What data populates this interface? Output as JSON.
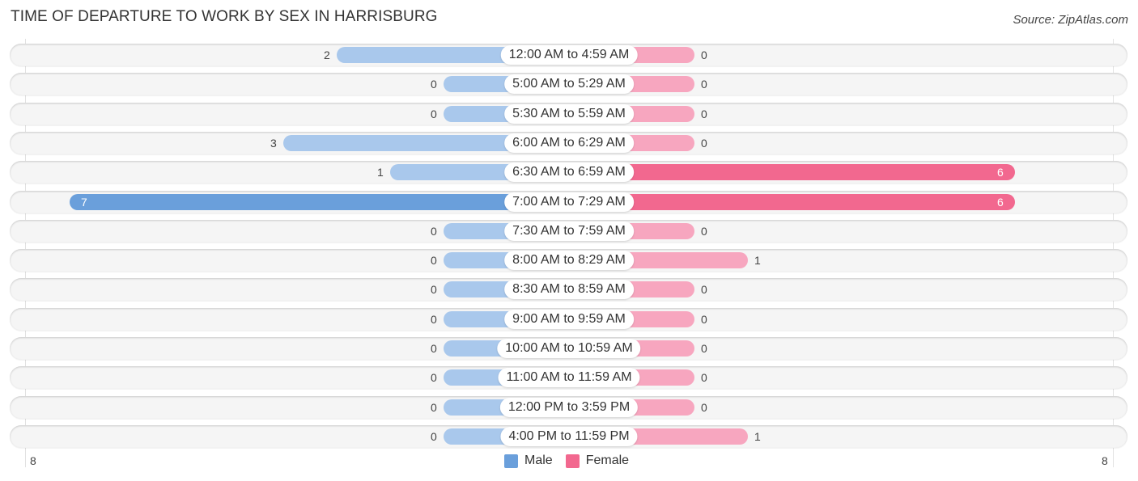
{
  "title": "TIME OF DEPARTURE TO WORK BY SEX IN HARRISBURG",
  "source": "Source: ZipAtlas.com",
  "colors": {
    "male": "#6a9fdb",
    "male_light": "#a9c8ec",
    "female": "#f2688f",
    "female_light": "#f7a6bf"
  },
  "chart_data": {
    "type": "bar",
    "orientation": "horizontal-diverging",
    "title": "TIME OF DEPARTURE TO WORK BY SEX IN HARRISBURG",
    "categories": [
      "12:00 AM to 4:59 AM",
      "5:00 AM to 5:29 AM",
      "5:30 AM to 5:59 AM",
      "6:00 AM to 6:29 AM",
      "6:30 AM to 6:59 AM",
      "7:00 AM to 7:29 AM",
      "7:30 AM to 7:59 AM",
      "8:00 AM to 8:29 AM",
      "8:30 AM to 8:59 AM",
      "9:00 AM to 9:59 AM",
      "10:00 AM to 10:59 AM",
      "11:00 AM to 11:59 AM",
      "12:00 PM to 3:59 PM",
      "4:00 PM to 11:59 PM"
    ],
    "series": [
      {
        "name": "Male",
        "values": [
          2,
          0,
          0,
          3,
          1,
          7,
          0,
          0,
          0,
          0,
          0,
          0,
          0,
          0
        ]
      },
      {
        "name": "Female",
        "values": [
          0,
          0,
          0,
          0,
          6,
          6,
          0,
          1,
          0,
          0,
          0,
          0,
          0,
          1
        ]
      }
    ],
    "axis": {
      "left_label": "8",
      "right_label": "8",
      "range": [
        -8,
        8
      ]
    },
    "legend": {
      "entries": [
        "Male",
        "Female"
      ],
      "placement": "bottom-center"
    }
  }
}
